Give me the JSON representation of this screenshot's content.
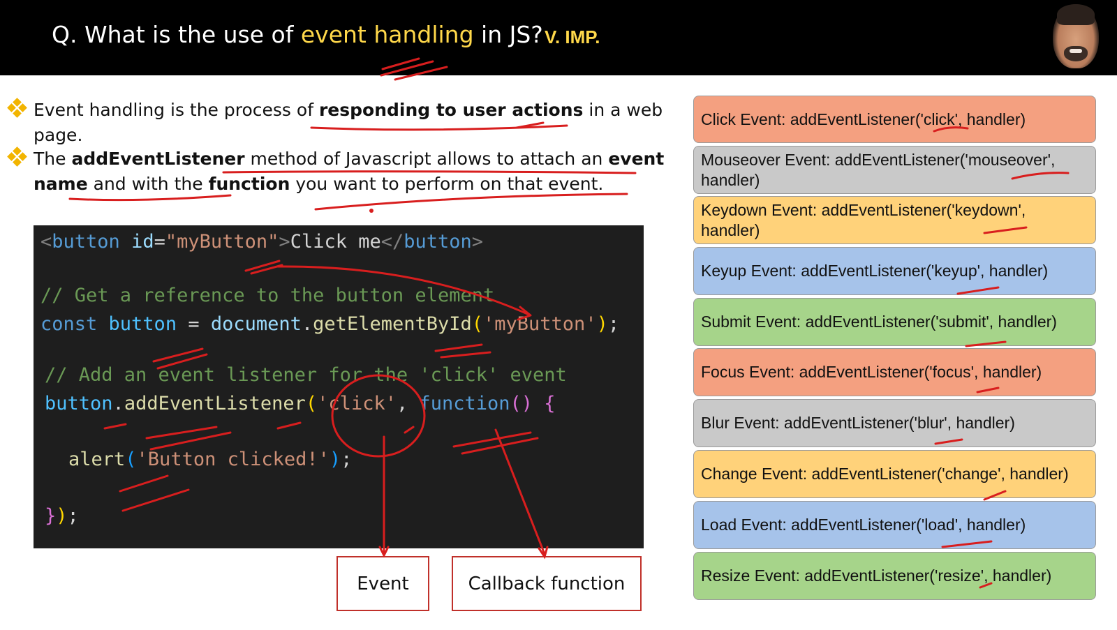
{
  "header": {
    "question_prefix": "Q. What is the use of ",
    "question_highlight": "event handling",
    "question_suffix": " in JS?",
    "importance_badge": "V. IMP."
  },
  "bullets": [
    {
      "parts": [
        "Event handling is the process of ",
        "responding to user actions",
        " in a web page."
      ]
    },
    {
      "parts": [
        "The ",
        "addEventListener",
        " method of Javascript allows to attach an ",
        "event name",
        " and with the ",
        "function",
        " you want to perform on that event."
      ]
    }
  ],
  "code": {
    "line1": {
      "lt": "<",
      "tag": "button",
      "attr": " id",
      "eq": "=",
      "val": "\"myButton\"",
      "gt": ">",
      "text": "Click me",
      "close_lt": "</",
      "close_tag": "button",
      "close_gt": ">"
    },
    "line2": "// Get a reference to the button element",
    "line3": {
      "kw": "const",
      "var": " button",
      "eq": " = ",
      "obj": "document",
      "dot": ".",
      "fn": "getElementById",
      "po": "(",
      "str": "'myButton'",
      "pc": ")",
      "end": ";"
    },
    "line4": "// Add an event listener for the 'click' event",
    "line5": {
      "var": "button",
      "dot": ".",
      "fn": "addEventListener",
      "po": "(",
      "str": "'click'",
      "comma": ", ",
      "kw": "function",
      "args": "()",
      "brace": " {"
    },
    "line6": {
      "fn": "alert",
      "po": "(",
      "str": "'Button clicked!'",
      "pc": ")",
      "end": ";"
    },
    "line7": {
      "brace": "}",
      "pc": ")",
      "end": ";"
    }
  },
  "annotations": {
    "event_label": "Event",
    "callback_label": "Callback function"
  },
  "events": [
    "Click Event: addEventListener('click', handler)",
    "Mouseover Event: addEventListener('mouseover', handler)",
    "Keydown Event: addEventListener('keydown', handler)",
    "Keyup Event: addEventListener('keyup', handler)",
    "Submit Event: addEventListener('submit', handler)",
    "Focus Event: addEventListener('focus', handler)",
    "Blur Event: addEventListener('blur', handler)",
    "Change Event: addEventListener('change', handler)",
    "Load Event: addEventListener('load', handler)",
    "Resize Event: addEventListener('resize', handler)"
  ],
  "colors": {
    "accent_yellow": "#ffd84a",
    "ink_red": "#d81e1e",
    "event_colors": [
      "#f4a080",
      "#c9c9c9",
      "#ffd27a",
      "#a6c3ea",
      "#a6d48a",
      "#f4a080",
      "#c9c9c9",
      "#ffd27a",
      "#a6c3ea",
      "#a6d48a"
    ]
  }
}
